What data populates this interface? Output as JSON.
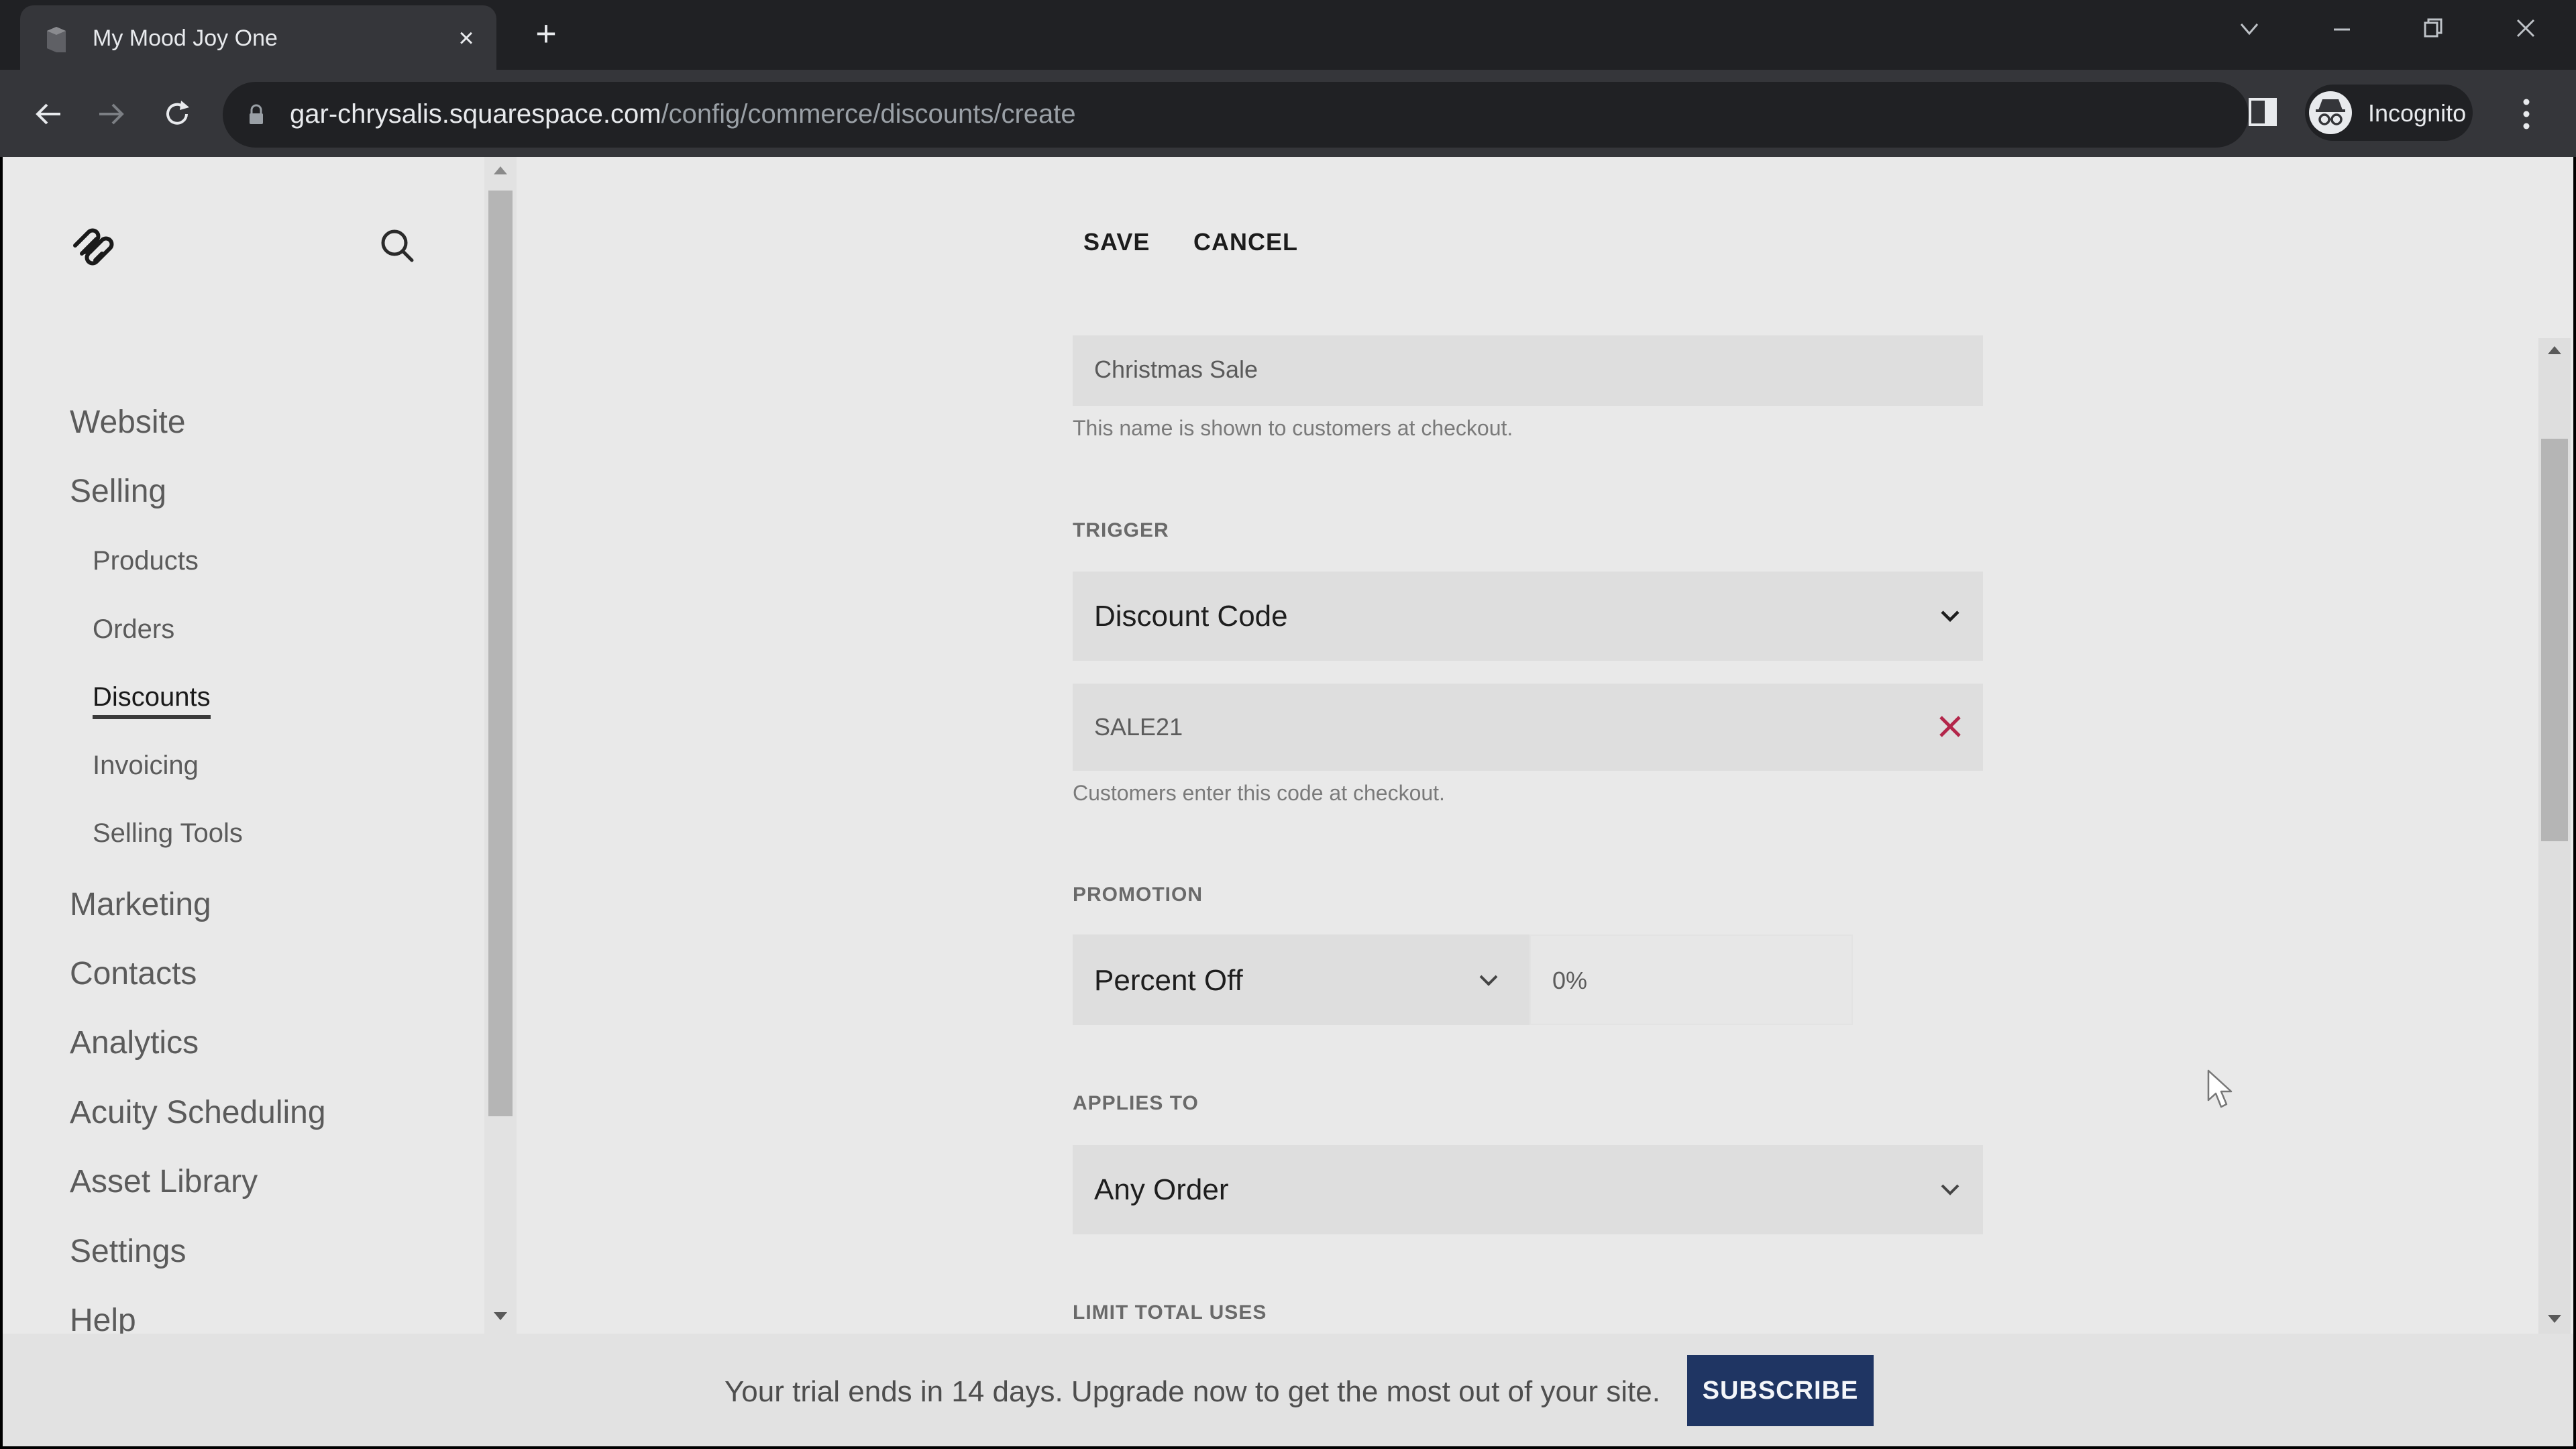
{
  "browser": {
    "tab_title": "My Mood Joy One",
    "new_tab_label": "+",
    "url_host": "gar-chrysalis.squarespace.com",
    "url_path": "/config/commerce/discounts/create",
    "profile_label": "Incognito"
  },
  "sidebar": {
    "items": [
      {
        "label": "Website",
        "level": 1
      },
      {
        "label": "Selling",
        "level": 1
      },
      {
        "label": "Products",
        "level": 2
      },
      {
        "label": "Orders",
        "level": 2
      },
      {
        "label": "Discounts",
        "level": 2,
        "active": true
      },
      {
        "label": "Invoicing",
        "level": 2
      },
      {
        "label": "Selling Tools",
        "level": 2
      },
      {
        "label": "Marketing",
        "level": 1
      },
      {
        "label": "Contacts",
        "level": 1
      },
      {
        "label": "Analytics",
        "level": 1
      },
      {
        "label": "Acuity Scheduling",
        "level": 1
      },
      {
        "label": "Asset Library",
        "level": 1
      },
      {
        "label": "Settings",
        "level": 1
      },
      {
        "label": "Help",
        "level": 1
      }
    ]
  },
  "toolbar": {
    "save_label": "SAVE",
    "cancel_label": "CANCEL"
  },
  "form": {
    "name": {
      "value": "Christmas Sale",
      "helper": "This name is shown to customers at checkout."
    },
    "trigger": {
      "label": "TRIGGER",
      "selected": "Discount Code",
      "code_value": "SALE21",
      "code_helper": "Customers enter this code at checkout."
    },
    "promotion": {
      "label": "PROMOTION",
      "selected": "Percent Off",
      "amount": "0%"
    },
    "applies_to": {
      "label": "APPLIES TO",
      "selected": "Any Order"
    },
    "limit_total_uses": {
      "label": "LIMIT TOTAL USES"
    }
  },
  "banner": {
    "text": "Your trial ends in 14 days. Upgrade now to get the most out of your site.",
    "button_label": "SUBSCRIBE"
  },
  "colors": {
    "accent_button": "#1f3563",
    "clear_icon": "#b3264a",
    "page_bg": "#e9e9e9",
    "field_bg": "#dedede"
  }
}
